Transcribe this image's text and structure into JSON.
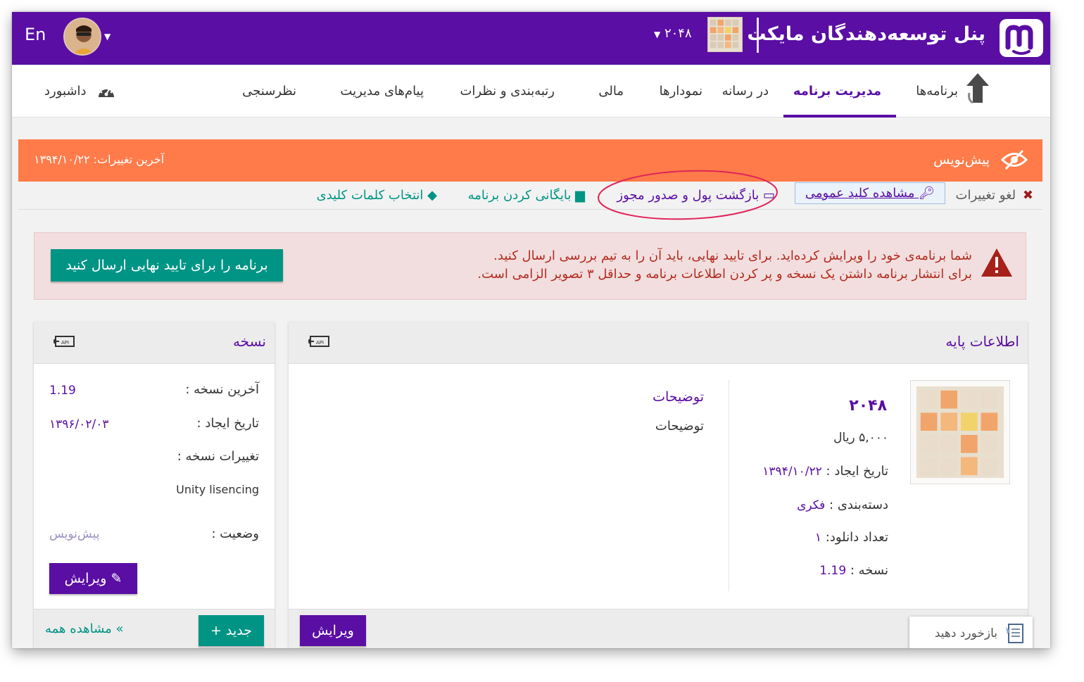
{
  "header": {
    "brand_title": "پنل توسعه‌دهندگان مایکت",
    "app_name": "۲۰۴۸",
    "lang": "En"
  },
  "nav": {
    "items": [
      {
        "label": "برنامه‌ها"
      },
      {
        "label": "مدیریت برنامه"
      },
      {
        "label": "در رسانه"
      },
      {
        "label": "نمودارها"
      },
      {
        "label": "مالی"
      },
      {
        "label": "رتبه‌بندی و نظرات"
      },
      {
        "label": "پیام‌های مدیریت"
      },
      {
        "label": "نظرسنجی"
      }
    ],
    "dashboard": "داشبورد"
  },
  "draft": {
    "label": "پیش‌نویس",
    "last_change": "آخرین تغییرات: ۱۳۹۴/۱۰/۲۲"
  },
  "actions": {
    "cancel": "لغو تغییرات",
    "public_key": "مشاهده کلید عمومی",
    "refund": "بازگشت پول و صدور مجوز",
    "archive": "بایگانی کردن برنامه",
    "keywords": "انتخاب کلمات کلیدی"
  },
  "alert": {
    "line1": "شما برنامه‌ی خود را ویرایش کرده‌اید. برای تایید نهایی، باید آن را به تیم بررسی ارسال کنید.",
    "line2": "برای انتشار برنامه داشتن یک نسخه و پر کردن اطلاعات برنامه و حداقل ۳ تصویر الزامی است.",
    "submit": "برنامه را برای تایید نهایی ارسال کنید"
  },
  "basic_info": {
    "title": "اطلاعات پایه",
    "app_name": "۲۰۴۸",
    "price": "۵,۰۰۰ ریال",
    "created_label": "تاریخ ایجاد :",
    "created_value": "۱۳۹۴/۱۰/۲۲",
    "category_label": "دسته‌بندی :",
    "category_value": "فکری",
    "downloads_label": "تعداد دانلود:",
    "downloads_value": "۱",
    "version_label": "نسخه :",
    "version_value": "1.19",
    "desc_title": "توضیحات",
    "desc_text": "توضیحات",
    "edit": "ویرایش"
  },
  "version": {
    "title": "نسخه",
    "latest_label": "آخرین نسخه :",
    "latest_value": "1.19",
    "created_label": "تاریخ ایجاد :",
    "created_value": "۱۳۹۶/۰۲/۰۳",
    "changes_label": "تغییرات نسخه :",
    "changes_value": "Unity lisencing",
    "status_label": "وضعیت :",
    "status_value": "پیش‌نویس",
    "edit": "ویرایش",
    "new": "جدید +",
    "view_all": "» مشاهده همه"
  },
  "feedback": "بازخورد دهید",
  "colors": {
    "primary": "#5a0ea4",
    "teal": "#009485",
    "orange": "#ff7b4a",
    "alert_bg": "#f2dede",
    "alert_text": "#b22b1f"
  }
}
